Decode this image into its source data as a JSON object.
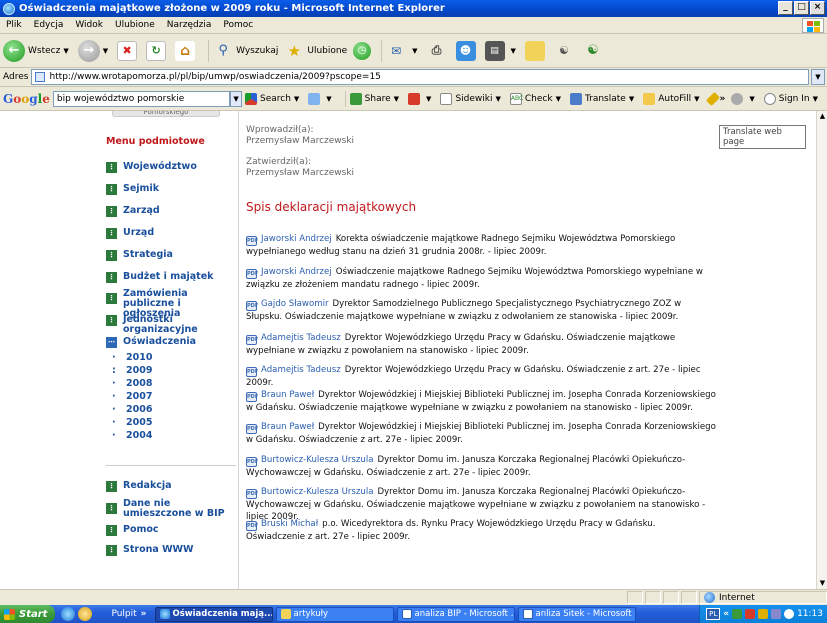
{
  "window": {
    "title": "Oświadczenia majątkowe złożone w 2009 roku - Microsoft Internet Explorer",
    "min_glyph": "_",
    "max_glyph": "□",
    "close_glyph": "×"
  },
  "menubar": {
    "items": [
      "Plik",
      "Edycja",
      "Widok",
      "Ulubione",
      "Narzędzia",
      "Pomoc"
    ]
  },
  "toolbar": {
    "back_label": "Wstecz",
    "search_label": "Wyszukaj",
    "favorites_label": "Ulubione"
  },
  "address": {
    "label": "Adres",
    "url": "http://www.wrotapomorza.pl/pl/bip/umwp/oswiadczenia/2009?pscope=15"
  },
  "google_bar": {
    "logo": [
      "G",
      "o",
      "o",
      "g",
      "l",
      "e"
    ],
    "query": "bip województwo pomorskie",
    "search_label": "Search",
    "share_label": "Share",
    "sidewiki_label": "Sidewiki",
    "check_label": "Check",
    "translate_label": "Translate",
    "autofill_label": "AutoFill",
    "more_label": "»",
    "signin_label": "Sign In"
  },
  "tooltip": {
    "text": "Translate web page"
  },
  "sidebar": {
    "top_tab": "Pomorskiego",
    "menu_title": "Menu podmiotowe",
    "items": [
      {
        "label": "Województwo"
      },
      {
        "label": "Sejmik"
      },
      {
        "label": "Zarząd"
      },
      {
        "label": "Urząd"
      },
      {
        "label": "Strategia"
      },
      {
        "label": "Budżet i majątek"
      },
      {
        "label": "Zamówienia publiczne i ogłoszenia"
      },
      {
        "label": "Jednostki organizacyjne"
      },
      {
        "label": "Oświadczenia"
      }
    ],
    "years": [
      "2010",
      "2009",
      "2008",
      "2007",
      "2006",
      "2005",
      "2004"
    ],
    "year_bullet": "·",
    "year_bullet_active": ":",
    "bottom_items": [
      {
        "label": "Redakcja"
      },
      {
        "label": "Dane nie umieszczone w BIP"
      },
      {
        "label": "Pomoc"
      },
      {
        "label": "Strona WWW"
      }
    ]
  },
  "main": {
    "entered_by_label": "Wprowadził(a):",
    "entered_by": "Przemysław Marczewski",
    "approved_by_label": "Zatwierdził(a):",
    "approved_by": "Przemysław Marczewski",
    "section_title": "Spis deklaracji majątkowych",
    "pdf_glyph": "PDF",
    "entries": [
      {
        "person": "Jaworski Andrzej",
        "text": "Korekta oświadczenie majątkowe Radnego Sejmiku Województwa Pomorskiego wypełnianego według stanu na dzień 31 grudnia 2008r. - lipiec 2009r."
      },
      {
        "person": "Jaworski Andrzej",
        "text": "Oświadczenie majątkowe Radnego Sejmiku Województwa Pomorskiego wypełniane w związku ze złożeniem mandatu radnego - lipiec 2009r."
      },
      {
        "person": "Gajdo Sławomir",
        "text": "Dyrektor Samodzielnego Publicznego Specjalistycznego Psychiatrycznego ZOZ w Słupsku. Oświadczenie majątkowe wypełniane w związku z odwołaniem ze stanowiska - lipiec 2009r."
      },
      {
        "person": "Adamejtis Tadeusz",
        "text": "Dyrektor Wojewódzkiego Urzędu Pracy w Gdańsku. Oświadczenie majątkowe wypełniane w związku z powołaniem na stanowisko - lipiec 2009r."
      },
      {
        "person": "Adamejtis Tadeusz",
        "text": "Dyrektor Wojewódzkiego Urzędu Pracy w Gdańsku. Oświadczenie z art. 27e - lipiec 2009r."
      },
      {
        "person": "Braun Paweł",
        "text": "Dyrektor Wojewódzkiej i Miejskiej Biblioteki Publicznej im. Josepha Conrada Korzeniowskiego w Gdańsku. Oświadczenie majątkowe wypełniane w związku z powołaniem na stanowisko - lipiec 2009r."
      },
      {
        "person": "Braun Paweł",
        "text": "Dyrektor Wojewódzkiej i Miejskiej Biblioteki Publicznej im. Josepha Conrada Korzeniowskiego w Gdańsku. Oświadczenie z art. 27e - lipiec 2009r."
      },
      {
        "person": "Burtowicz-Kulesza Urszula",
        "text": "Dyrektor Domu im. Janusza Korczaka Regionalnej Placówki Opiekuńczo-Wychowawczej w Gdańsku. Oświadczenie z art. 27e - lipiec 2009r."
      },
      {
        "person": "Burtowicz-Kulesza Urszula",
        "text": "Dyrektor Domu im. Janusza Korczaka Regionalnej Placówki Opiekuńczo-Wychowawczej w Gdańsku. Oświadczenie majątkowe wypełniane w związku z powołaniem na stanowisko - lipiec 2009r."
      },
      {
        "person": "Bruski Michał",
        "text": "p.o. Wicedyrektora ds. Rynku Pracy Wojewódzkiego Urzędu Pracy w Gdańsku. Oświadczenie z art. 27e - lipiec 2009r."
      }
    ]
  },
  "statusbar": {
    "zone": "Internet"
  },
  "taskbar": {
    "start": "Start",
    "desktop_label": "Pulpit",
    "more": "»",
    "tasks": [
      {
        "label": "Oświadczenia mają...",
        "active": true
      },
      {
        "label": "artykuły",
        "active": false
      },
      {
        "label": "analiza BIP - Microsoft ...",
        "active": false
      },
      {
        "label": "anliza Sitek - Microsoft ...",
        "active": false
      }
    ],
    "lang": "PL",
    "clock": "11:13"
  },
  "colors": {
    "accent_red": "#c0181b",
    "nav_blue": "#1a4f9c",
    "link_blue": "#2a5fb0",
    "nav_square_green": "#2b7a3c"
  }
}
